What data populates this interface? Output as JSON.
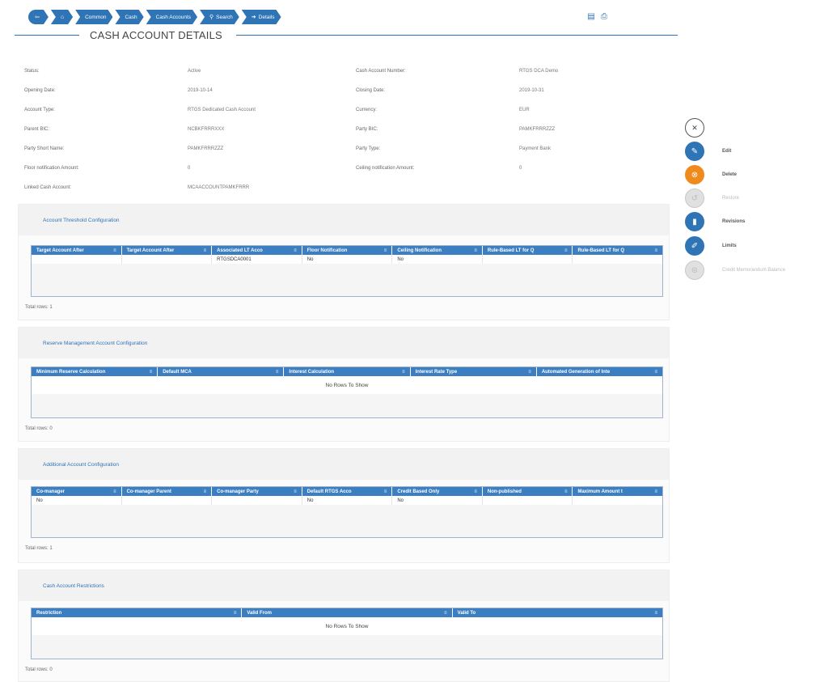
{
  "breadcrumb": {
    "items": [
      "Common",
      "Cash",
      "Cash Accounts",
      "Search",
      "Details"
    ]
  },
  "page": {
    "title": "CASH ACCOUNT DETAILS"
  },
  "details": {
    "left": [
      {
        "label": "Status:",
        "value": "Active"
      },
      {
        "label": "Opening Date:",
        "value": "2019-10-14"
      },
      {
        "label": "Account Type:",
        "value": "RTGS Dedicated Cash Account"
      },
      {
        "label": "Parent BIC:",
        "value": "NCBKFRRRXXX"
      },
      {
        "label": "Party Short Name:",
        "value": "PAMKFRRRZZZ"
      },
      {
        "label": "Floor notification Amount:",
        "value": "0"
      },
      {
        "label": "Linked Cash Account:",
        "value": "MCAACCOUNTPAMKFRRR"
      }
    ],
    "right": [
      {
        "label": "Cash Account Number:",
        "value": "RTGS DCA Demo"
      },
      {
        "label": "Closing Date:",
        "value": "2019-10-31"
      },
      {
        "label": "Currency:",
        "value": "EUR"
      },
      {
        "label": "Party BIC:",
        "value": "PAMKFRRRZZZ"
      },
      {
        "label": "Party Type:",
        "value": "Payment Bank"
      },
      {
        "label": "Ceiling notification Amount:",
        "value": "0"
      }
    ]
  },
  "sections": {
    "threshold": {
      "title": "Account Threshold Configuration",
      "columns": [
        "Target Account After",
        "Target Account After",
        "Associated LT Acco",
        "Floor Notification",
        "Ceiling Notification",
        "Rule-Based LT for Q",
        "Rule-Based LT for Q"
      ],
      "rows": [
        [
          "",
          "",
          "RTGSDCA0001",
          "No",
          "No",
          "",
          ""
        ]
      ],
      "total": "Total rows: 1"
    },
    "reserve": {
      "title": "Reserve Management Account Configuration",
      "columns": [
        "Minimum Reserve Calculation",
        "Default MCA",
        "Interest Calculation",
        "Interest Rate Type",
        "Automated Generation of Inte"
      ],
      "no_rows": "No Rows To Show",
      "total": "Total rows: 0"
    },
    "additional": {
      "title": "Additional Account Configuration",
      "columns": [
        "Co-manager",
        "Co-manager Parent",
        "Co-manager Party",
        "Default RTGS Acco",
        "Credit Based Only",
        "Non-published",
        "Maximum Amount t"
      ],
      "rows": [
        [
          "No",
          "",
          "",
          "No",
          "No",
          "",
          ""
        ]
      ],
      "total": "Total rows: 1"
    },
    "restrictions": {
      "title": "Cash Account Restrictions",
      "columns": [
        "Restriction",
        "Valid From",
        "Valid To"
      ],
      "no_rows": "No Rows To Show",
      "total": "Total rows: 0"
    }
  },
  "actions": {
    "edit": "Edit",
    "delete": "Delete",
    "restore": "Restore",
    "revisions": "Revisions",
    "limits": "Limits",
    "credit_memorandum": "Credit Memorandum Balance"
  },
  "colors": {
    "accent": "#2f74b5",
    "grid_header": "#3b7ec2",
    "delete": "#f08a1c",
    "disabled": "#e0e0e0"
  }
}
